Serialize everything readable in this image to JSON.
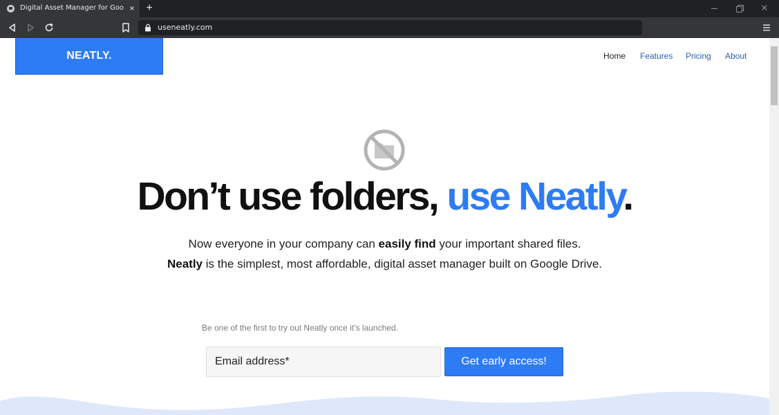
{
  "browser": {
    "tab_title": "Digital Asset Manager for Google",
    "tab_close": "×",
    "new_tab": "+",
    "window_close": "✕",
    "url": "useneatly.com"
  },
  "site": {
    "logo": "NEATLY.",
    "nav": [
      "Home",
      "Features",
      "Pricing",
      "About"
    ]
  },
  "hero": {
    "icon": "no-folder-icon",
    "headline_main": "Don’t use folders, ",
    "headline_accent": "use Neatly",
    "headline_end": ".",
    "sub1_before": "Now everyone in your company can ",
    "sub1_bold": "easily find",
    "sub1_after": " your important shared files.",
    "sub2_bold": "Neatly",
    "sub2_after": " is the simplest, most affordable, digital asset manager built on Google Drive."
  },
  "signup": {
    "tagline": "Be one of the first to try out Neatly once it’s launched.",
    "email_placeholder": "Email address*",
    "button_label": "Get early access!"
  },
  "colors": {
    "accent": "#2d7cf6",
    "wave": "#dfe7fb"
  }
}
